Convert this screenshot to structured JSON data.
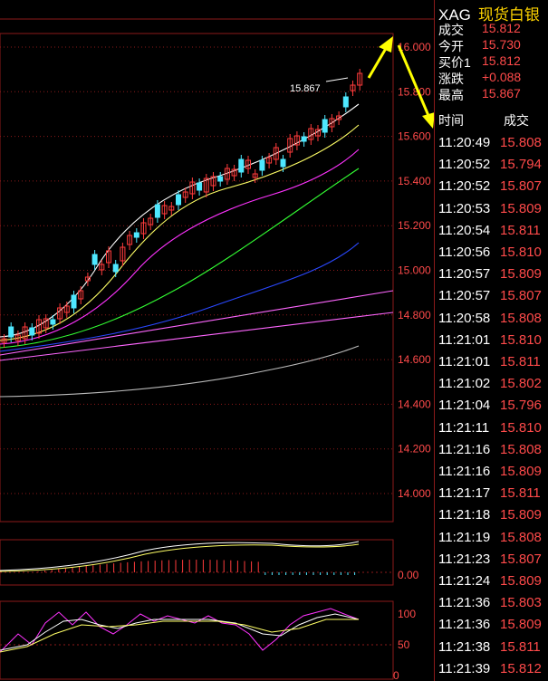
{
  "quote": {
    "code": "XAG",
    "name": "现货白银",
    "fields": [
      {
        "label": "成交",
        "value": "15.812"
      },
      {
        "label": "今开",
        "value": "15.730"
      },
      {
        "label": "买价1",
        "value": "15.812"
      },
      {
        "label": "涨跌",
        "value": "+0.088"
      },
      {
        "label": "最高",
        "value": "15.867"
      }
    ]
  },
  "ticks": {
    "header_time": "时间",
    "header_price": "成交",
    "rows": [
      {
        "time": "11:20:49",
        "price": "15.808"
      },
      {
        "time": "11:20:52",
        "price": "15.794"
      },
      {
        "time": "11:20:52",
        "price": "15.807"
      },
      {
        "time": "11:20:53",
        "price": "15.809"
      },
      {
        "time": "11:20:54",
        "price": "15.811"
      },
      {
        "time": "11:20:56",
        "price": "15.810"
      },
      {
        "time": "11:20:57",
        "price": "15.809"
      },
      {
        "time": "11:20:57",
        "price": "15.807"
      },
      {
        "time": "11:20:58",
        "price": "15.808"
      },
      {
        "time": "11:21:01",
        "price": "15.810"
      },
      {
        "time": "11:21:01",
        "price": "15.811"
      },
      {
        "time": "11:21:02",
        "price": "15.802"
      },
      {
        "time": "11:21:04",
        "price": "15.796"
      },
      {
        "time": "11:21:11",
        "price": "15.810"
      },
      {
        "time": "11:21:16",
        "price": "15.808"
      },
      {
        "time": "11:21:16",
        "price": "15.809"
      },
      {
        "time": "11:21:17",
        "price": "15.811"
      },
      {
        "time": "11:21:18",
        "price": "15.809"
      },
      {
        "time": "11:21:19",
        "price": "15.808"
      },
      {
        "time": "11:21:23",
        "price": "15.807"
      },
      {
        "time": "11:21:24",
        "price": "15.809"
      },
      {
        "time": "11:21:36",
        "price": "15.803"
      },
      {
        "time": "11:21:36",
        "price": "15.809"
      },
      {
        "time": "11:21:38",
        "price": "15.811"
      },
      {
        "time": "11:21:39",
        "price": "15.812"
      }
    ]
  },
  "chart": {
    "colors": {
      "up": "#ff3b3b",
      "down": "#4ee8ff",
      "grid": "#8b1a1a",
      "ma5": "#ffffff",
      "ma10": "#ffff66",
      "ma20": "#ff33ff",
      "ma40": "#33ff33",
      "ma60": "#2a48ff",
      "ma_long": "#ff66ff",
      "ma_gray": "#aaaaaa"
    },
    "price_axis": [
      "16.000",
      "15.800",
      "15.600",
      "15.400",
      "15.200",
      "15.000",
      "14.800",
      "14.600",
      "14.400",
      "14.200",
      "14.000"
    ],
    "max_label": "15.867",
    "macd_axis": "0.00",
    "kdj_axis": [
      "100",
      "50",
      "0"
    ]
  }
}
